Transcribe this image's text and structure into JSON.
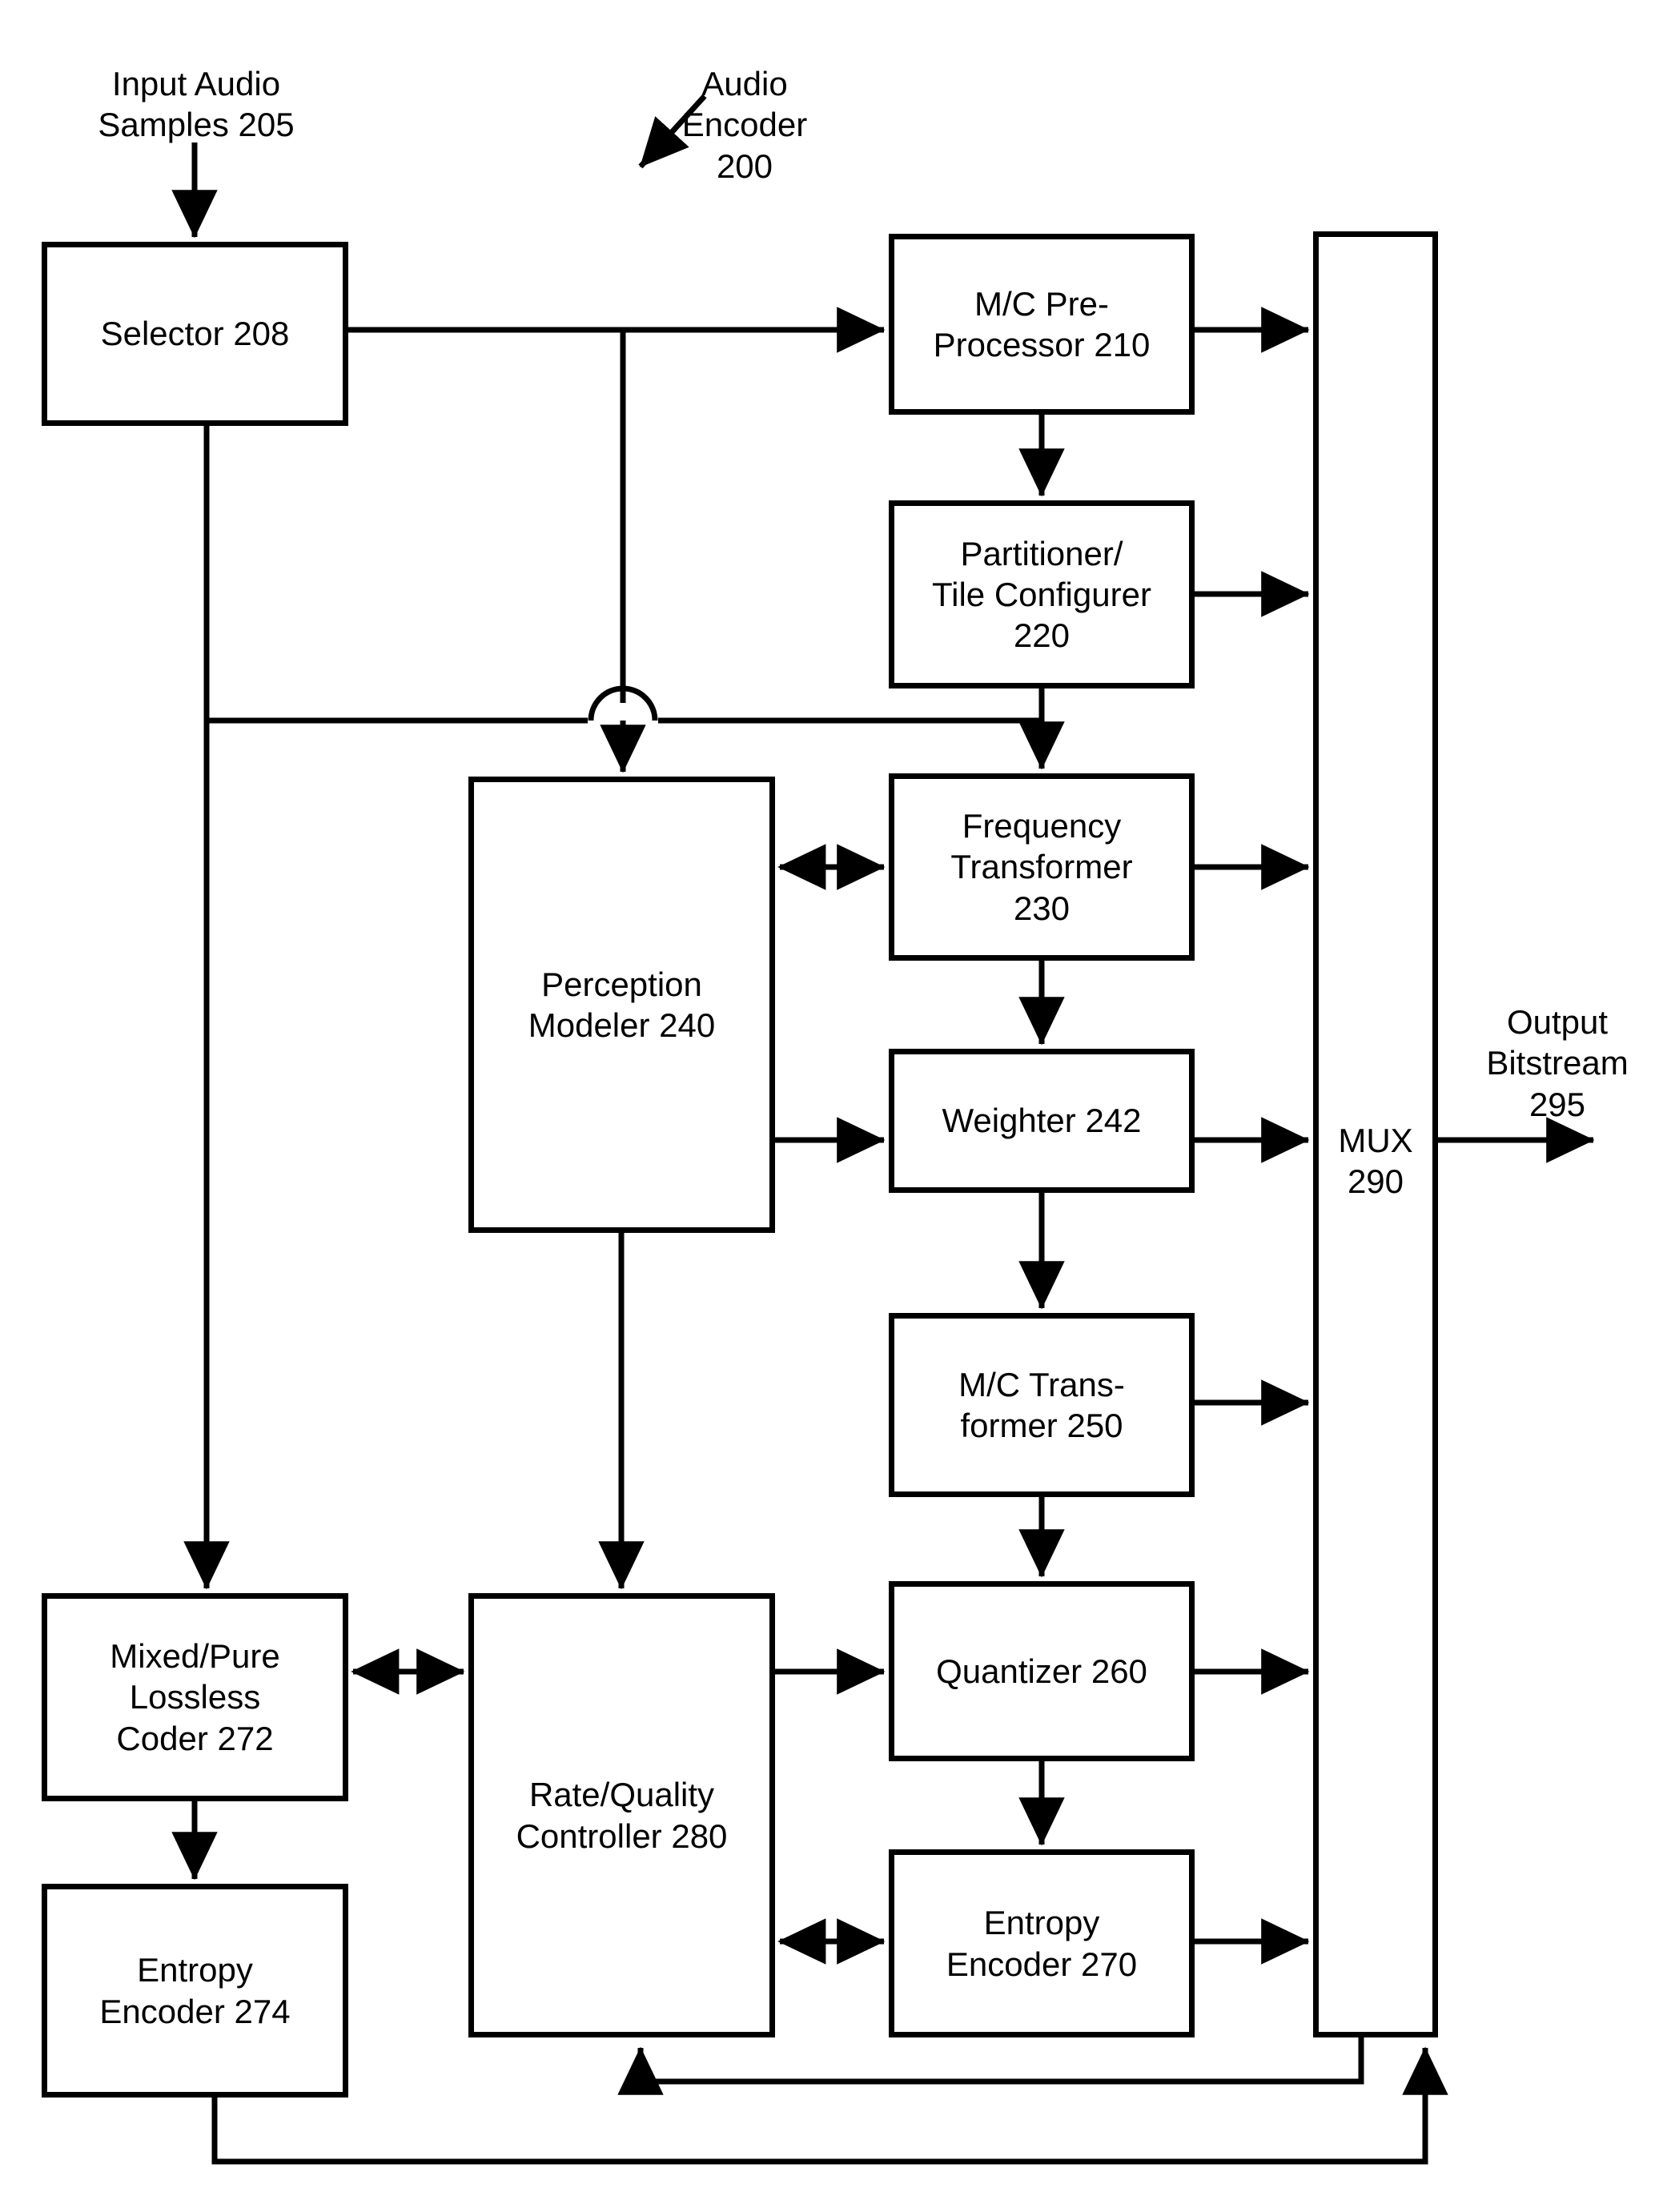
{
  "figure": {
    "title": "Audio Encoder 200 block diagram",
    "stroke_color": "#000000",
    "background_color": "#ffffff"
  },
  "labels": {
    "input_audio_samples": "Input Audio\nSamples 205",
    "audio_encoder": "Audio\nEncoder\n200",
    "output_bitstream": "Output\nBitstream\n295"
  },
  "blocks": {
    "selector": "Selector 208",
    "mc_pre_processor": "M/C Pre-\nProcessor 210",
    "partitioner_tile_configurer": "Partitioner/\nTile Configurer\n220",
    "frequency_transformer": "Frequency\nTransformer\n230",
    "perception_modeler": "Perception\nModeler 240",
    "weighter": "Weighter 242",
    "mc_transformer": "M/C Trans-\nformer 250",
    "quantizer": "Quantizer 260",
    "entropy_encoder_270": "Entropy\nEncoder 270",
    "mixed_pure_lossless_coder": "Mixed/Pure\nLossless\nCoder 272",
    "entropy_encoder_274": "Entropy\nEncoder 274",
    "rate_quality_controller": "Rate/Quality\nController 280",
    "mux": "MUX\n290"
  }
}
